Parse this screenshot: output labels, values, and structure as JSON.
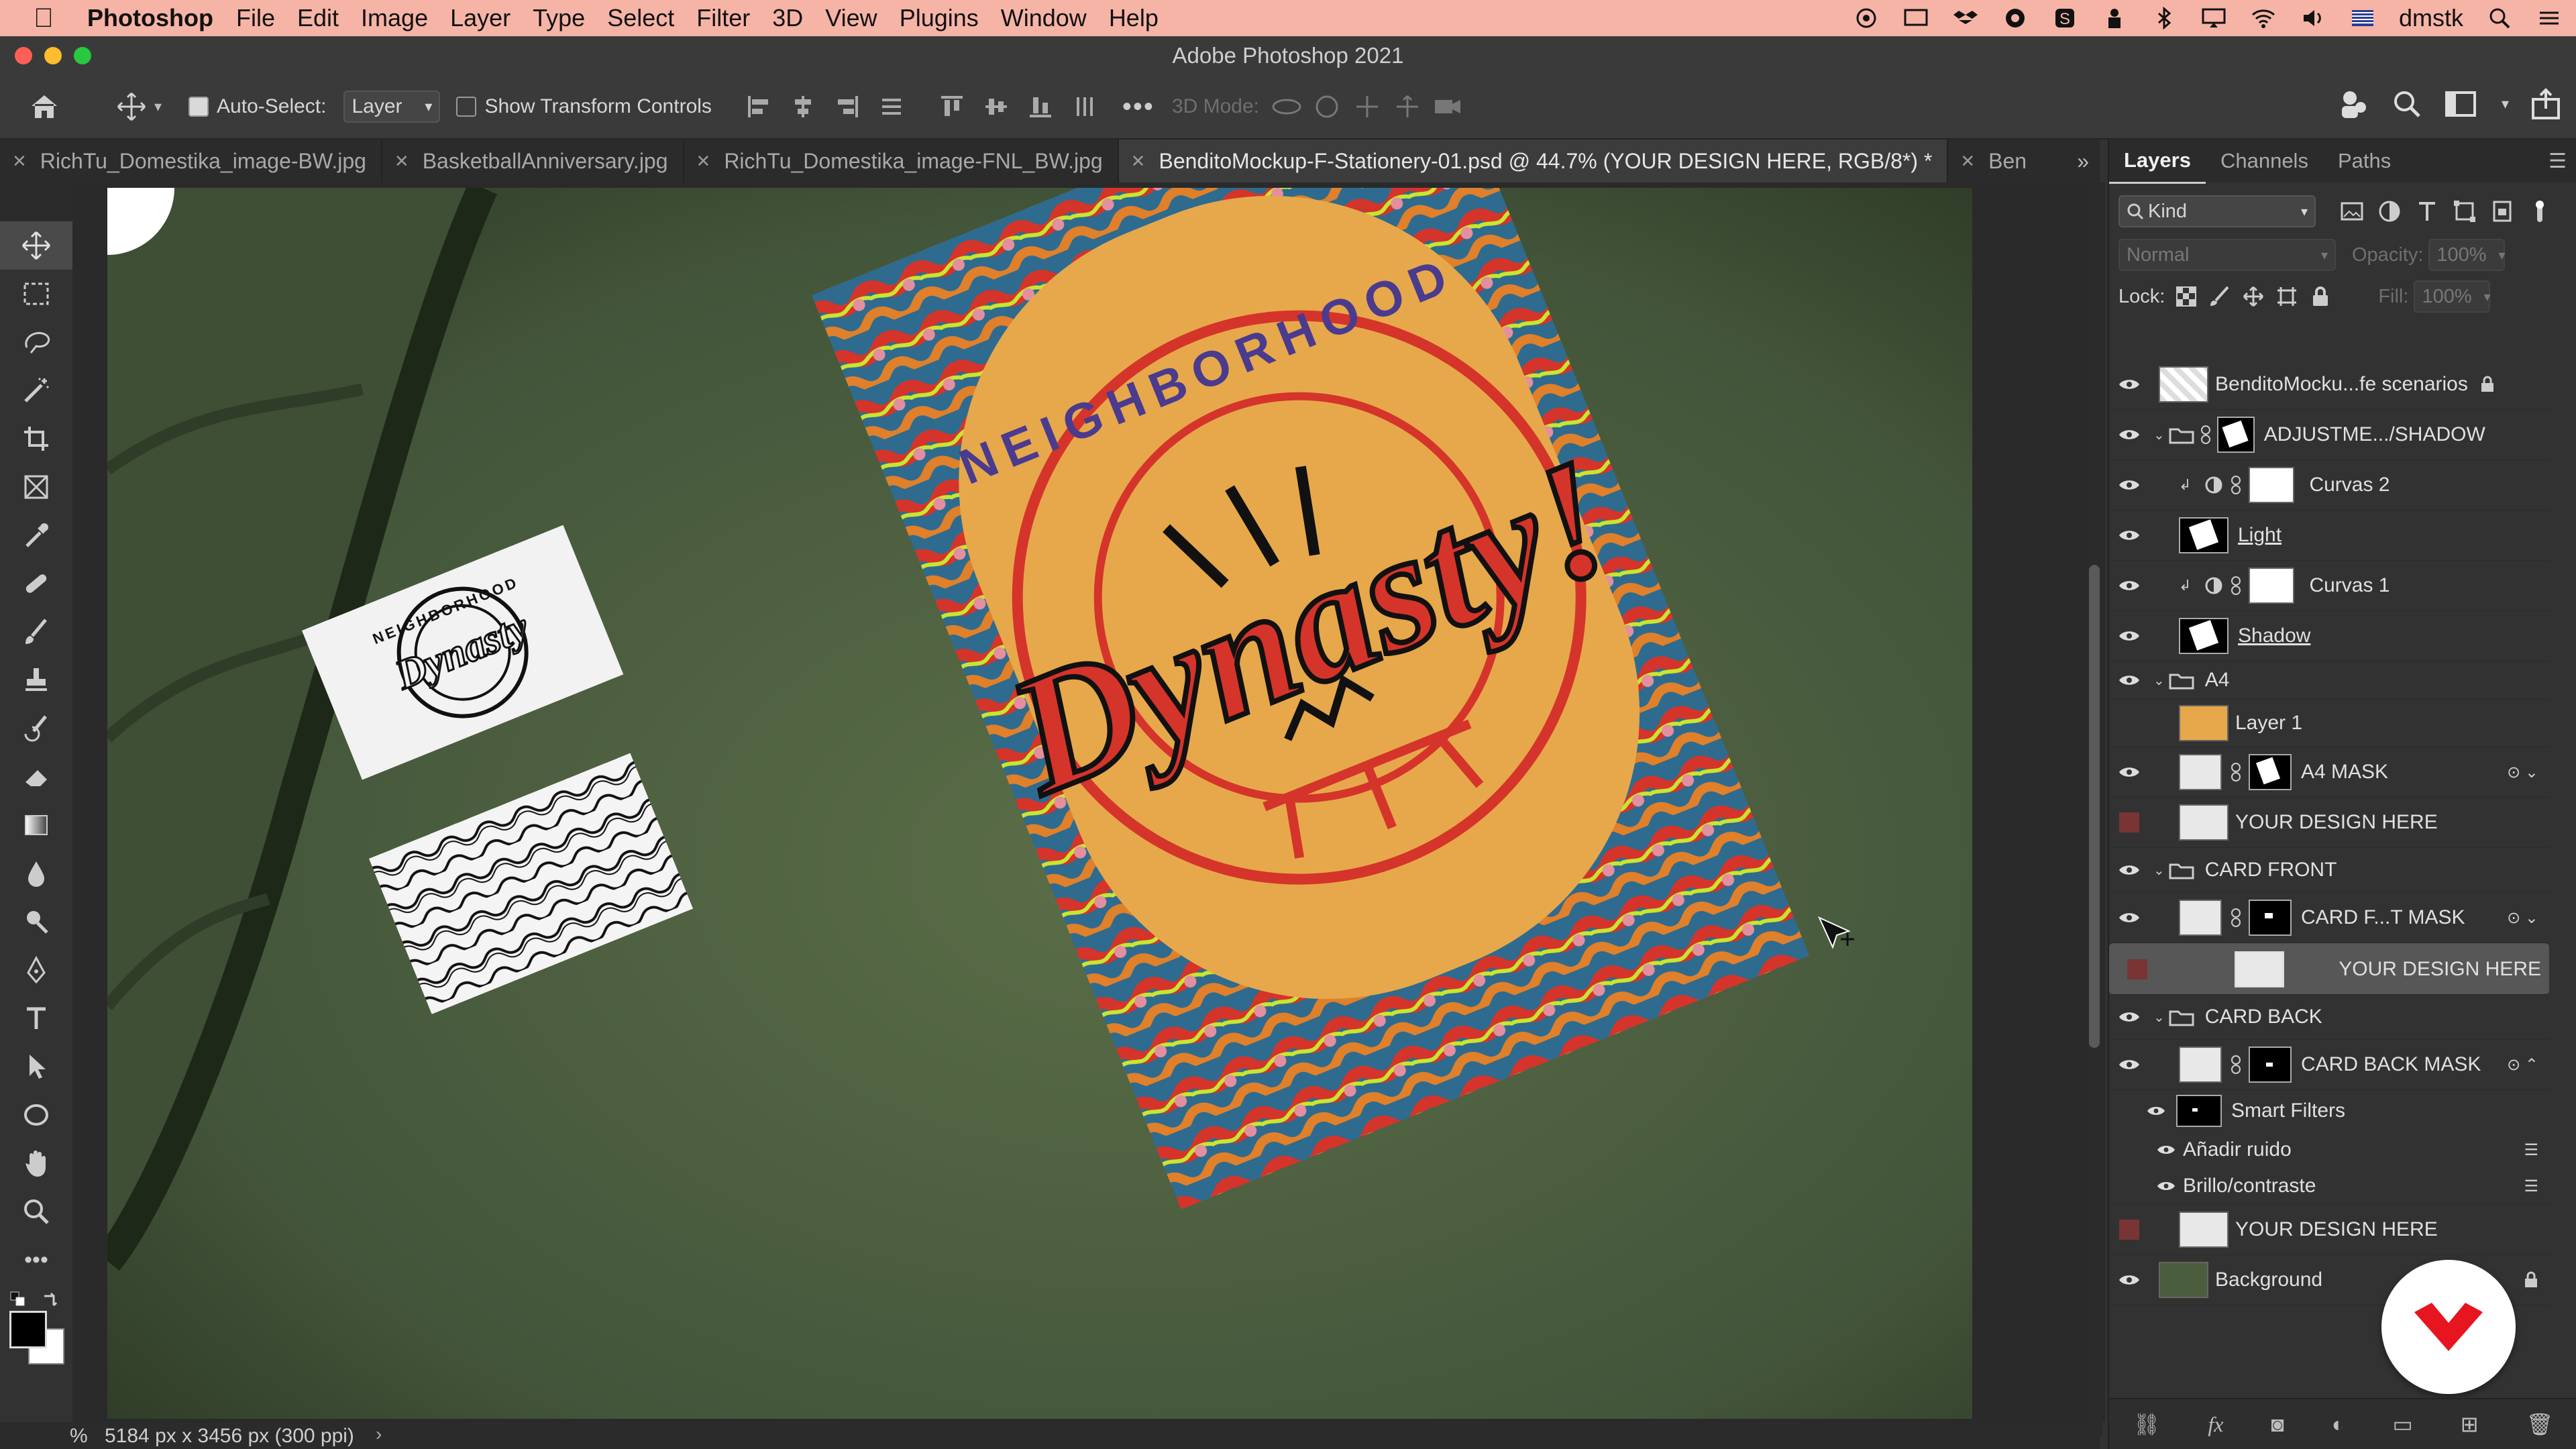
{
  "menubar": {
    "app_name": "Photoshop",
    "items": [
      "File",
      "Edit",
      "Image",
      "Layer",
      "Type",
      "Select",
      "Filter",
      "3D",
      "View",
      "Plugins",
      "Window",
      "Help"
    ],
    "user": "dmstk",
    "status_icons": [
      "cc-icon",
      "screen-icon",
      "dropbox-icon",
      "account-icon",
      "s-icon",
      "person-icon",
      "bluetooth-icon",
      "display-icon",
      "wifi-icon",
      "volume-icon",
      "flag-icon"
    ]
  },
  "window": {
    "title": "Adobe Photoshop 2021"
  },
  "options": {
    "auto_select_label": "Auto-Select:",
    "auto_select_checked": true,
    "auto_select_value": "Layer",
    "transform_label": "Show Transform Controls",
    "mode3d_label": "3D Mode:"
  },
  "tabs": [
    {
      "label": "RichTu_Domestika_image-BW.jpg",
      "active": false
    },
    {
      "label": "BasketballAnniversary.jpg",
      "active": false
    },
    {
      "label": "RichTu_Domestika_image-FNL_BW.jpg",
      "active": false
    },
    {
      "label": "BenditoMockup-F-Stationery-01.psd @ 44.7% (YOUR DESIGN HERE, RGB/8*) *",
      "active": true
    },
    {
      "label": "Ben",
      "active": false
    }
  ],
  "artwork": {
    "ring_text": "NEIGHBORHOOD",
    "script_text": "Dynasty!",
    "card_ring_text": "NEIGHBORHOOD",
    "card_script_text": "Dynasty"
  },
  "status": {
    "doc_info": "5184 px x 3456 px (300 ppi)",
    "zoom_suffix": "%"
  },
  "panels": {
    "tabs": [
      "Layers",
      "Channels",
      "Paths"
    ],
    "filter_kind": "Kind",
    "blend_mode": "Normal",
    "opacity_label": "Opacity:",
    "opacity_value": "100%",
    "lock_label": "Lock:",
    "fill_label": "Fill:",
    "fill_value": "100%",
    "layers": [
      {
        "name": "BenditoMocku...fe scenarios",
        "indent": 0,
        "type": "layer",
        "visible": true,
        "locked": true
      },
      {
        "name": "ADJUSTME.../SHADOW",
        "indent": 0,
        "type": "group",
        "visible": true
      },
      {
        "name": "Curvas 2",
        "indent": 1,
        "type": "adjustment",
        "visible": true
      },
      {
        "name": "Light",
        "indent": 1,
        "type": "layer",
        "visible": true,
        "underline": true
      },
      {
        "name": "Curvas 1",
        "indent": 1,
        "type": "adjustment",
        "visible": true
      },
      {
        "name": "Shadow",
        "indent": 1,
        "type": "layer",
        "visible": true,
        "underline": true
      },
      {
        "name": "A4",
        "indent": 0,
        "type": "group",
        "visible": true
      },
      {
        "name": "Layer 1",
        "indent": 1,
        "type": "layer",
        "visible": false
      },
      {
        "name": "A4 MASK",
        "indent": 1,
        "type": "smart",
        "visible": true
      },
      {
        "name": "YOUR DESIGN HERE",
        "indent": 1,
        "type": "layer",
        "visible": false,
        "red": true
      },
      {
        "name": "CARD FRONT",
        "indent": 0,
        "type": "group",
        "visible": true
      },
      {
        "name": "CARD F...T MASK",
        "indent": 1,
        "type": "smart",
        "visible": true
      },
      {
        "name": "YOUR DESIGN HERE",
        "indent": 1,
        "type": "layer",
        "visible": false,
        "red": true,
        "selected": true
      },
      {
        "name": "CARD BACK",
        "indent": 0,
        "type": "group",
        "visible": true
      },
      {
        "name": "CARD BACK MASK",
        "indent": 1,
        "type": "smart",
        "visible": true
      },
      {
        "name": "Smart Filters",
        "indent": 2,
        "type": "filters",
        "visible": true
      },
      {
        "name": "Añadir ruido",
        "indent": 3,
        "type": "filter",
        "visible": true
      },
      {
        "name": "Brillo/contraste",
        "indent": 3,
        "type": "filter",
        "visible": true
      },
      {
        "name": "YOUR DESIGN HERE",
        "indent": 1,
        "type": "layer",
        "visible": false,
        "red": true
      },
      {
        "name": "Background",
        "indent": 0,
        "type": "layer",
        "visible": true,
        "locked": true
      }
    ]
  },
  "colors": {
    "menubar": "#f6b4a6",
    "poster": "#e6a84b",
    "script_red": "#d5342a",
    "leather": "#4a5d3c",
    "domestika_badge": "#ffffff"
  }
}
